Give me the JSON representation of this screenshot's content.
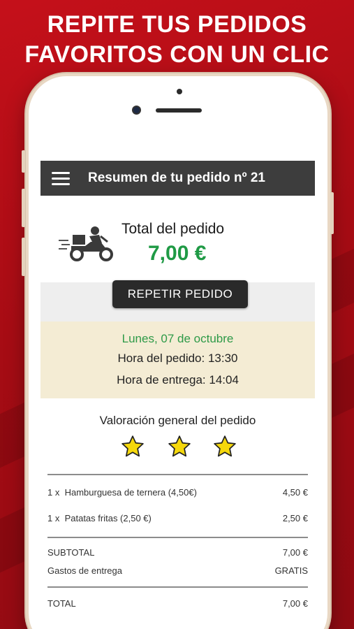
{
  "headline": {
    "line1": "REPITE TUS PEDIDOS",
    "line2": "FAVORITOS CON UN CLIC"
  },
  "app_bar": {
    "menu_icon": "hamburger-menu-icon",
    "title": "Resumen de tu pedido nº 21"
  },
  "order_total": {
    "icon": "delivery-scooter-icon",
    "label": "Total del pedido",
    "amount": "7,00 €",
    "amount_color": "#1f9a45"
  },
  "repeat_button": {
    "label": "REPETIR PEDIDO"
  },
  "order_times": {
    "date": "Lunes, 07 de octubre",
    "order_time": "Hora del pedido: 13:30",
    "delivery_time": "Hora de entrega: 14:04"
  },
  "rating": {
    "title": "Valoración general del pedido",
    "stars": 3,
    "star_color": "#f5d80c"
  },
  "items": [
    {
      "qty": "1 x",
      "name": "Hamburguesa de ternera (4,50€)",
      "price": "4,50 €"
    },
    {
      "qty": "1 x",
      "name": "Patatas fritas (2,50 €)",
      "price": "2,50 €"
    }
  ],
  "summary": {
    "subtotal_label": "SUBTOTAL",
    "subtotal_value": "7,00 €",
    "shipping_label": "Gastos de entrega",
    "shipping_value": "GRATIS",
    "total_label": "TOTAL",
    "total_value": "7,00 €"
  },
  "colors": {
    "brand_red": "#c5101a",
    "app_bar": "#3d3d3d",
    "date_band": "#f4ecd4"
  }
}
